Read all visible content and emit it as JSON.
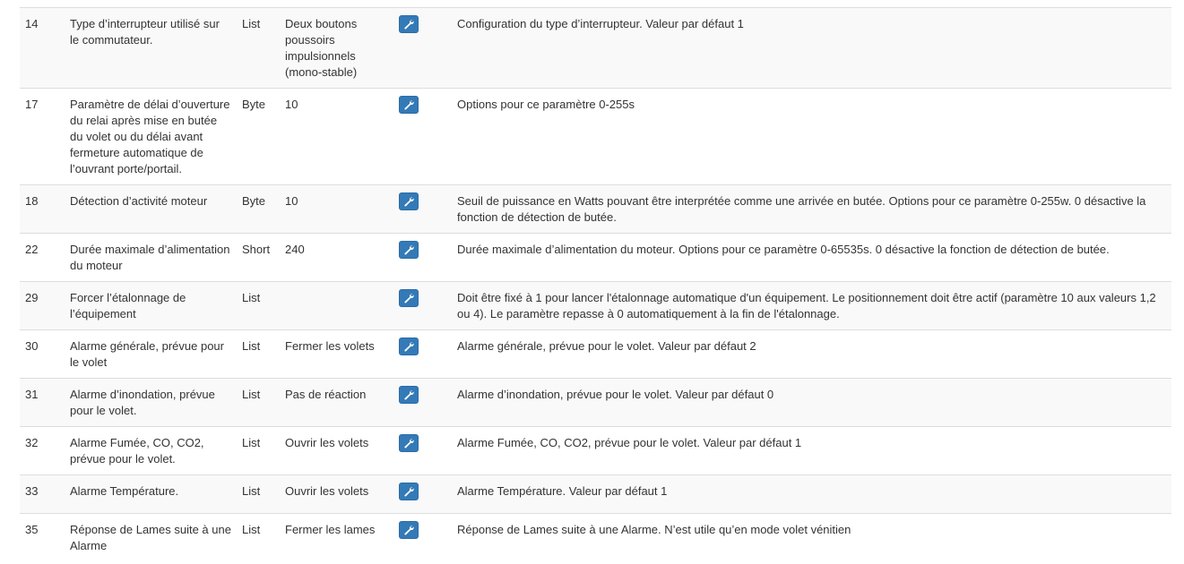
{
  "accent_color": "#337ab7",
  "rows": [
    {
      "id": "14",
      "name": "Type d’interrupteur utilisé sur le commutateur.",
      "type": "List",
      "value": "Deux boutons poussoirs impulsionnels (mono-stable)",
      "icon": "wrench-icon",
      "description": "Configuration du type d’interrupteur. Valeur par défaut 1"
    },
    {
      "id": "17",
      "name": "Paramètre de délai d’ouverture du relai après mise en butée du volet ou du délai avant fermeture automatique de l’ouvrant porte/portail.",
      "type": "Byte",
      "value": "10",
      "icon": "wrench-icon",
      "description": "Options pour ce paramètre 0-255s"
    },
    {
      "id": "18",
      "name": "Détection d’activité moteur",
      "type": "Byte",
      "value": "10",
      "icon": "wrench-icon",
      "description": "Seuil de puissance en Watts pouvant être interprétée comme une arrivée en butée. Options pour ce paramètre 0-255w. 0 désactive la fonction de détection de butée."
    },
    {
      "id": "22",
      "name": "Durée maximale d’alimentation du moteur",
      "type": "Short",
      "value": "240",
      "icon": "wrench-icon",
      "description": "Durée maximale d’alimentation du moteur. Options pour ce paramètre 0-65535s. 0 désactive la fonction de détection de butée."
    },
    {
      "id": "29",
      "name": "Forcer l’étalonnage de l’équipement",
      "type": "List",
      "value": "",
      "icon": "wrench-icon",
      "description": "Doit être fixé à 1 pour lancer l'étalonnage automatique d'un équipement. Le positionnement doit être actif (paramètre 10 aux valeurs 1,2 ou 4). Le paramètre repasse à 0 automatiquement à la fin de l'étalonnage."
    },
    {
      "id": "30",
      "name": "Alarme générale, prévue pour le volet",
      "type": "List",
      "value": "Fermer les volets",
      "icon": "wrench-icon",
      "description": "Alarme générale, prévue pour le volet. Valeur par défaut 2"
    },
    {
      "id": "31",
      "name": "Alarme d’inondation, prévue pour le volet.",
      "type": "List",
      "value": "Pas de réaction",
      "icon": "wrench-icon",
      "description": "Alarme d’inondation, prévue pour le volet. Valeur par défaut 0"
    },
    {
      "id": "32",
      "name": "Alarme Fumée, CO, CO2, prévue pour le volet.",
      "type": "List",
      "value": "Ouvrir les volets",
      "icon": "wrench-icon",
      "description": "Alarme Fumée, CO, CO2, prévue pour le volet. Valeur par défaut 1"
    },
    {
      "id": "33",
      "name": "Alarme Température.",
      "type": "List",
      "value": "Ouvrir les volets",
      "icon": "wrench-icon",
      "description": "Alarme Température. Valeur par défaut 1"
    },
    {
      "id": "35",
      "name": "Réponse de Lames suite à une Alarme",
      "type": "List",
      "value": "Fermer les lames",
      "icon": "wrench-icon",
      "description": "Réponse de Lames suite à une Alarme. N’est utile qu’en mode volet vénitien"
    }
  ]
}
